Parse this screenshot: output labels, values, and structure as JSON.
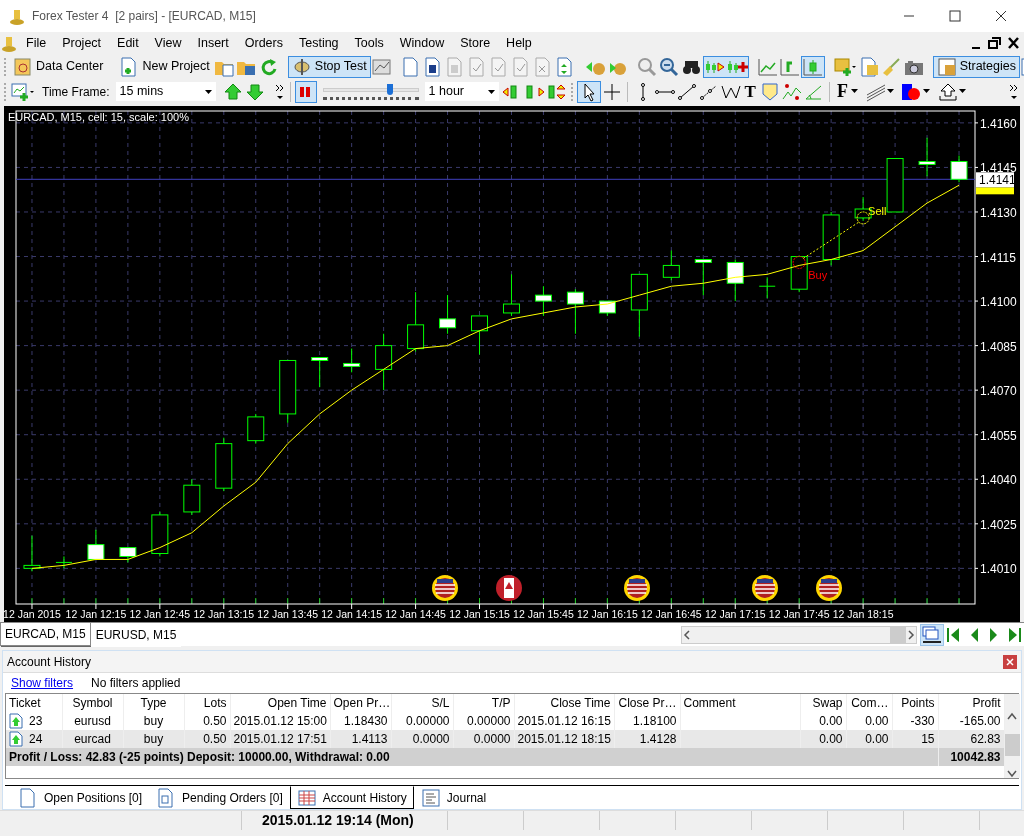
{
  "window": {
    "title": "Forex Tester 4  [2 pairs] - [EURCAD, M15]"
  },
  "menu": [
    "File",
    "Project",
    "Edit",
    "View",
    "Insert",
    "Orders",
    "Testing",
    "Tools",
    "Window",
    "Store",
    "Help"
  ],
  "toolbar": {
    "buttons": [
      {
        "kind": "data-center",
        "label": "Data Center",
        "pressed": false
      },
      {
        "kind": "new-project",
        "label": "New Project",
        "pressed": false
      },
      {
        "kind": "stop-test",
        "label": "Stop Test",
        "pressed": true
      },
      {
        "kind": "strategies",
        "label": "Strategies",
        "pressed": true
      }
    ]
  },
  "testing_bar": {
    "time_frame_label": "Time Frame:",
    "time_frame": "15 mins",
    "paused": true,
    "speed": {
      "level": 0.72
    },
    "jump": "1 hour",
    "text_tool": "T",
    "font_tool": "F"
  },
  "chart": {
    "title": "EURCAD, M15, cell: 15, scale: 100%",
    "events": [
      {
        "kind": "us"
      },
      {
        "kind": "ca"
      },
      {
        "kind": "us"
      },
      {
        "kind": "us"
      },
      {
        "kind": "us"
      }
    ],
    "chart_data": {
      "type": "candlestick",
      "grid": true,
      "ylim": [
        1.3998,
        1.4164
      ],
      "categories": [
        "12 Jan 2015",
        null,
        "12 Jan 12:15",
        null,
        "12 Jan 12:45",
        null,
        "12 Jan 13:15",
        null,
        "12 Jan 13:45",
        null,
        "12 Jan 14:15",
        null,
        "12 Jan 14:45",
        null,
        "12 Jan 15:15",
        null,
        "12 Jan 15:45",
        null,
        "12 Jan 16:15",
        null,
        "12 Jan 16:45",
        null,
        "12 Jan 17:15",
        null,
        "12 Jan 17:45",
        null,
        "12 Jan 18:15",
        null,
        null,
        null
      ],
      "yticks": [
        {
          "value": 1.416,
          "label": "1.4160"
        },
        {
          "value": 1.4145,
          "label": "1.4145"
        },
        {
          "value": 1.413,
          "label": "1.4130"
        },
        {
          "value": 1.4115,
          "label": "1.4115"
        },
        {
          "value": 1.41,
          "label": "1.4100"
        },
        {
          "value": 1.4085,
          "label": "1.4085"
        },
        {
          "value": 1.407,
          "label": "1.4070"
        },
        {
          "value": 1.4055,
          "label": "1.4055"
        },
        {
          "value": 1.404,
          "label": "1.4040"
        },
        {
          "value": 1.4025,
          "label": "1.4025"
        },
        {
          "value": 1.401,
          "label": "1.4010"
        }
      ],
      "ohlc": [
        [
          1.401,
          1.4021,
          1.4009,
          1.4011
        ],
        [
          1.4012,
          1.4014,
          1.401,
          1.4012
        ],
        [
          1.4018,
          1.4023,
          1.4013,
          1.4013
        ],
        [
          1.4017,
          1.4017,
          1.4012,
          1.4014
        ],
        [
          1.4015,
          1.4029,
          1.4014,
          1.4028
        ],
        [
          1.4029,
          1.404,
          1.4028,
          1.4038
        ],
        [
          1.4037,
          1.4054,
          1.4036,
          1.4052
        ],
        [
          1.4053,
          1.4062,
          1.4052,
          1.4061
        ],
        [
          1.4062,
          1.408,
          1.4059,
          1.408
        ],
        [
          1.4081,
          1.4081,
          1.4071,
          1.408
        ],
        [
          1.4079,
          1.4084,
          1.4076,
          1.4078
        ],
        [
          1.4077,
          1.4089,
          1.407,
          1.4085
        ],
        [
          1.4084,
          1.4103,
          1.4083,
          1.4092
        ],
        [
          1.4094,
          1.4102,
          1.4089,
          1.4091
        ],
        [
          1.409,
          1.4095,
          1.4082,
          1.4095
        ],
        [
          1.4096,
          1.4109,
          1.4095,
          1.4099
        ],
        [
          1.4102,
          1.4105,
          1.4095,
          1.41
        ],
        [
          1.4103,
          1.4104,
          1.4089,
          1.4099
        ],
        [
          1.41,
          1.41,
          1.4095,
          1.4096
        ],
        [
          1.4097,
          1.4109,
          1.4088,
          1.4109
        ],
        [
          1.4108,
          1.4117,
          1.4107,
          1.4112
        ],
        [
          1.4114,
          1.4114,
          1.4102,
          1.4113
        ],
        [
          1.4113,
          1.4114,
          1.41,
          1.4106
        ],
        [
          1.4105,
          1.4108,
          1.4101,
          1.4105
        ],
        [
          1.4104,
          1.4115,
          1.4103,
          1.4115
        ],
        [
          1.4114,
          1.413,
          1.4112,
          1.4129
        ],
        [
          1.4128,
          1.4135,
          1.4127,
          1.4131
        ],
        [
          1.413,
          1.4148,
          1.413,
          1.4148
        ],
        [
          1.4147,
          1.4155,
          1.4142,
          1.4146
        ],
        [
          1.4147,
          1.4149,
          1.414,
          1.4141
        ]
      ],
      "series": [
        {
          "type": "line",
          "color": "#ffff00",
          "values": [
            1.401,
            1.4011,
            1.4013,
            1.4013,
            1.4017,
            1.4022,
            1.4031,
            1.4039,
            1.4052,
            1.4062,
            1.407,
            1.4077,
            1.4084,
            1.4085,
            1.409,
            1.4094,
            1.4096,
            1.4098,
            1.4099,
            1.4102,
            1.4105,
            1.4106,
            1.4108,
            1.4109,
            1.4112,
            1.4114,
            1.4117,
            1.4125,
            1.4133,
            1.4139
          ]
        }
      ],
      "ref_lines": [
        {
          "axis": "y",
          "value": 1.4141,
          "label": "1.4141"
        }
      ],
      "annotations": [
        "Buy",
        "Sell"
      ]
    }
  },
  "chart_tabs": [
    {
      "label": "EURCAD, M15",
      "selected": true
    },
    {
      "label": "EURUSD, M15",
      "selected": false
    }
  ],
  "account_history": {
    "title": "Account History",
    "filters_link": "Show filters",
    "filters_status": "No filters applied",
    "columns": [
      "Ticket",
      "Symbol",
      "Type",
      "Lots",
      "Open Time",
      "Open Pr…",
      "S/L",
      "T/P",
      "Close Time",
      "Close Pr…",
      "Comment",
      "Swap",
      "Com…",
      "Points",
      "Profit"
    ],
    "rows": [
      {
        "selected": false,
        "cells": [
          "23",
          "eurusd",
          "buy",
          "0.50",
          "2015.01.12 15:00",
          "1.18430",
          "0.00000",
          "0.00000",
          "2015.01.12 16:15",
          "1.18100",
          "",
          "0.00",
          "0.00",
          "-330",
          "-165.00"
        ]
      },
      {
        "selected": true,
        "cells": [
          "24",
          "eurcad",
          "buy",
          "0.50",
          "2015.01.12 17:51",
          "1.4113",
          "0.0000",
          "0.0000",
          "2015.01.12 18:15",
          "1.4128",
          "",
          "0.00",
          "0.00",
          "15",
          "62.83"
        ]
      }
    ],
    "summary": "Profit / Loss: 42.83 (-25 points) Deposit: 10000.00, Withdrawal: 0.00",
    "balance": "10042.83"
  },
  "bottom_tabs": [
    {
      "kind": "doc",
      "label": "Open Positions [0]",
      "selected": false
    },
    {
      "kind": "pending",
      "label": "Pending Orders [0]",
      "selected": false
    },
    {
      "kind": "table",
      "label": "Account History",
      "selected": true
    },
    {
      "kind": "journal",
      "label": "Journal",
      "selected": false
    }
  ],
  "status_bar": {
    "datetime": "2015.01.12 19:14 (Mon)"
  }
}
